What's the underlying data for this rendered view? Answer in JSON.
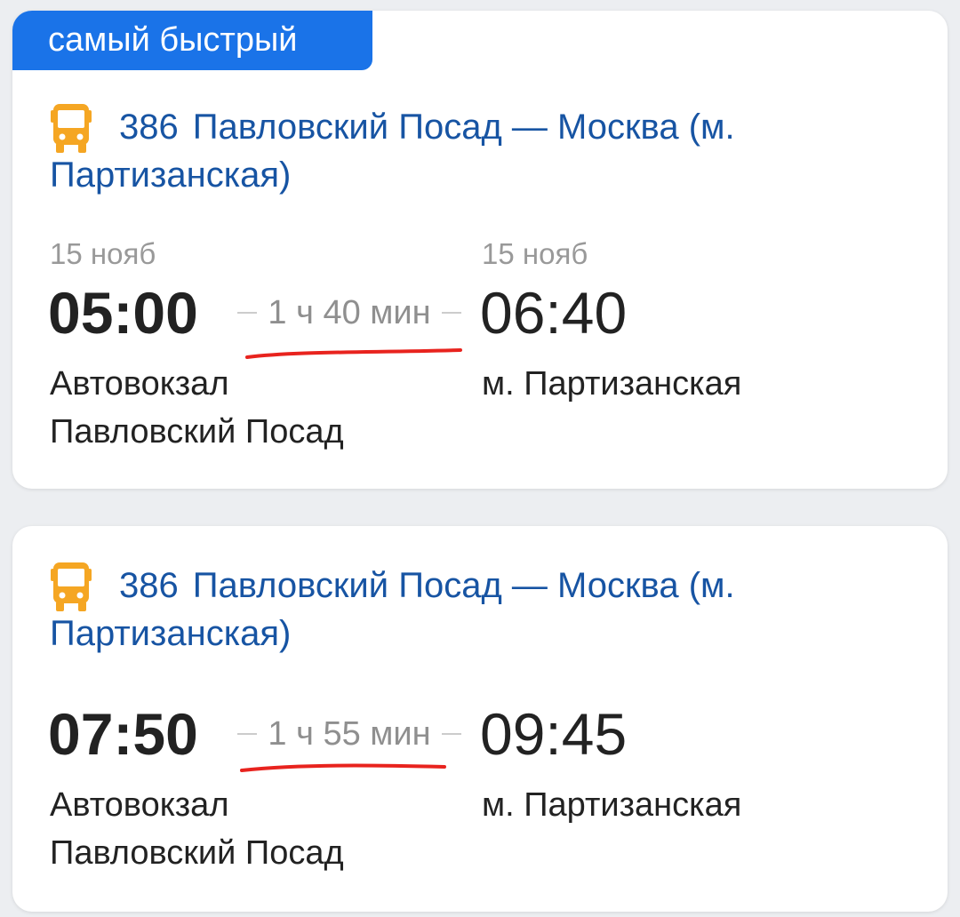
{
  "colors": {
    "badge_bg": "#1a73e8",
    "route_link": "#1754a3",
    "bus_icon": "#f5a623",
    "annotation_line": "#e8231e"
  },
  "trips": [
    {
      "badge": "самый быстрый",
      "icon": "bus-icon",
      "route_number": "386",
      "route_name": "Павловский Посад — Москва (м. Партизанская)",
      "departure_date": "15 нояб",
      "arrival_date": "15 нояб",
      "departure_time": "05:00",
      "duration": "1 ч 40 мин",
      "arrival_time": "06:40",
      "departure_station": [
        "Автовокзал",
        "Павловский Посад"
      ],
      "arrival_station": "м. Партизанская"
    },
    {
      "icon": "bus-icon",
      "route_number": "386",
      "route_name": "Павловский Посад — Москва (м. Партизанская)",
      "departure_time": "07:50",
      "duration": "1 ч 55 мин",
      "arrival_time": "09:45",
      "departure_station": [
        "Автовокзал",
        "Павловский Посад"
      ],
      "arrival_station": "м. Партизанская"
    }
  ]
}
